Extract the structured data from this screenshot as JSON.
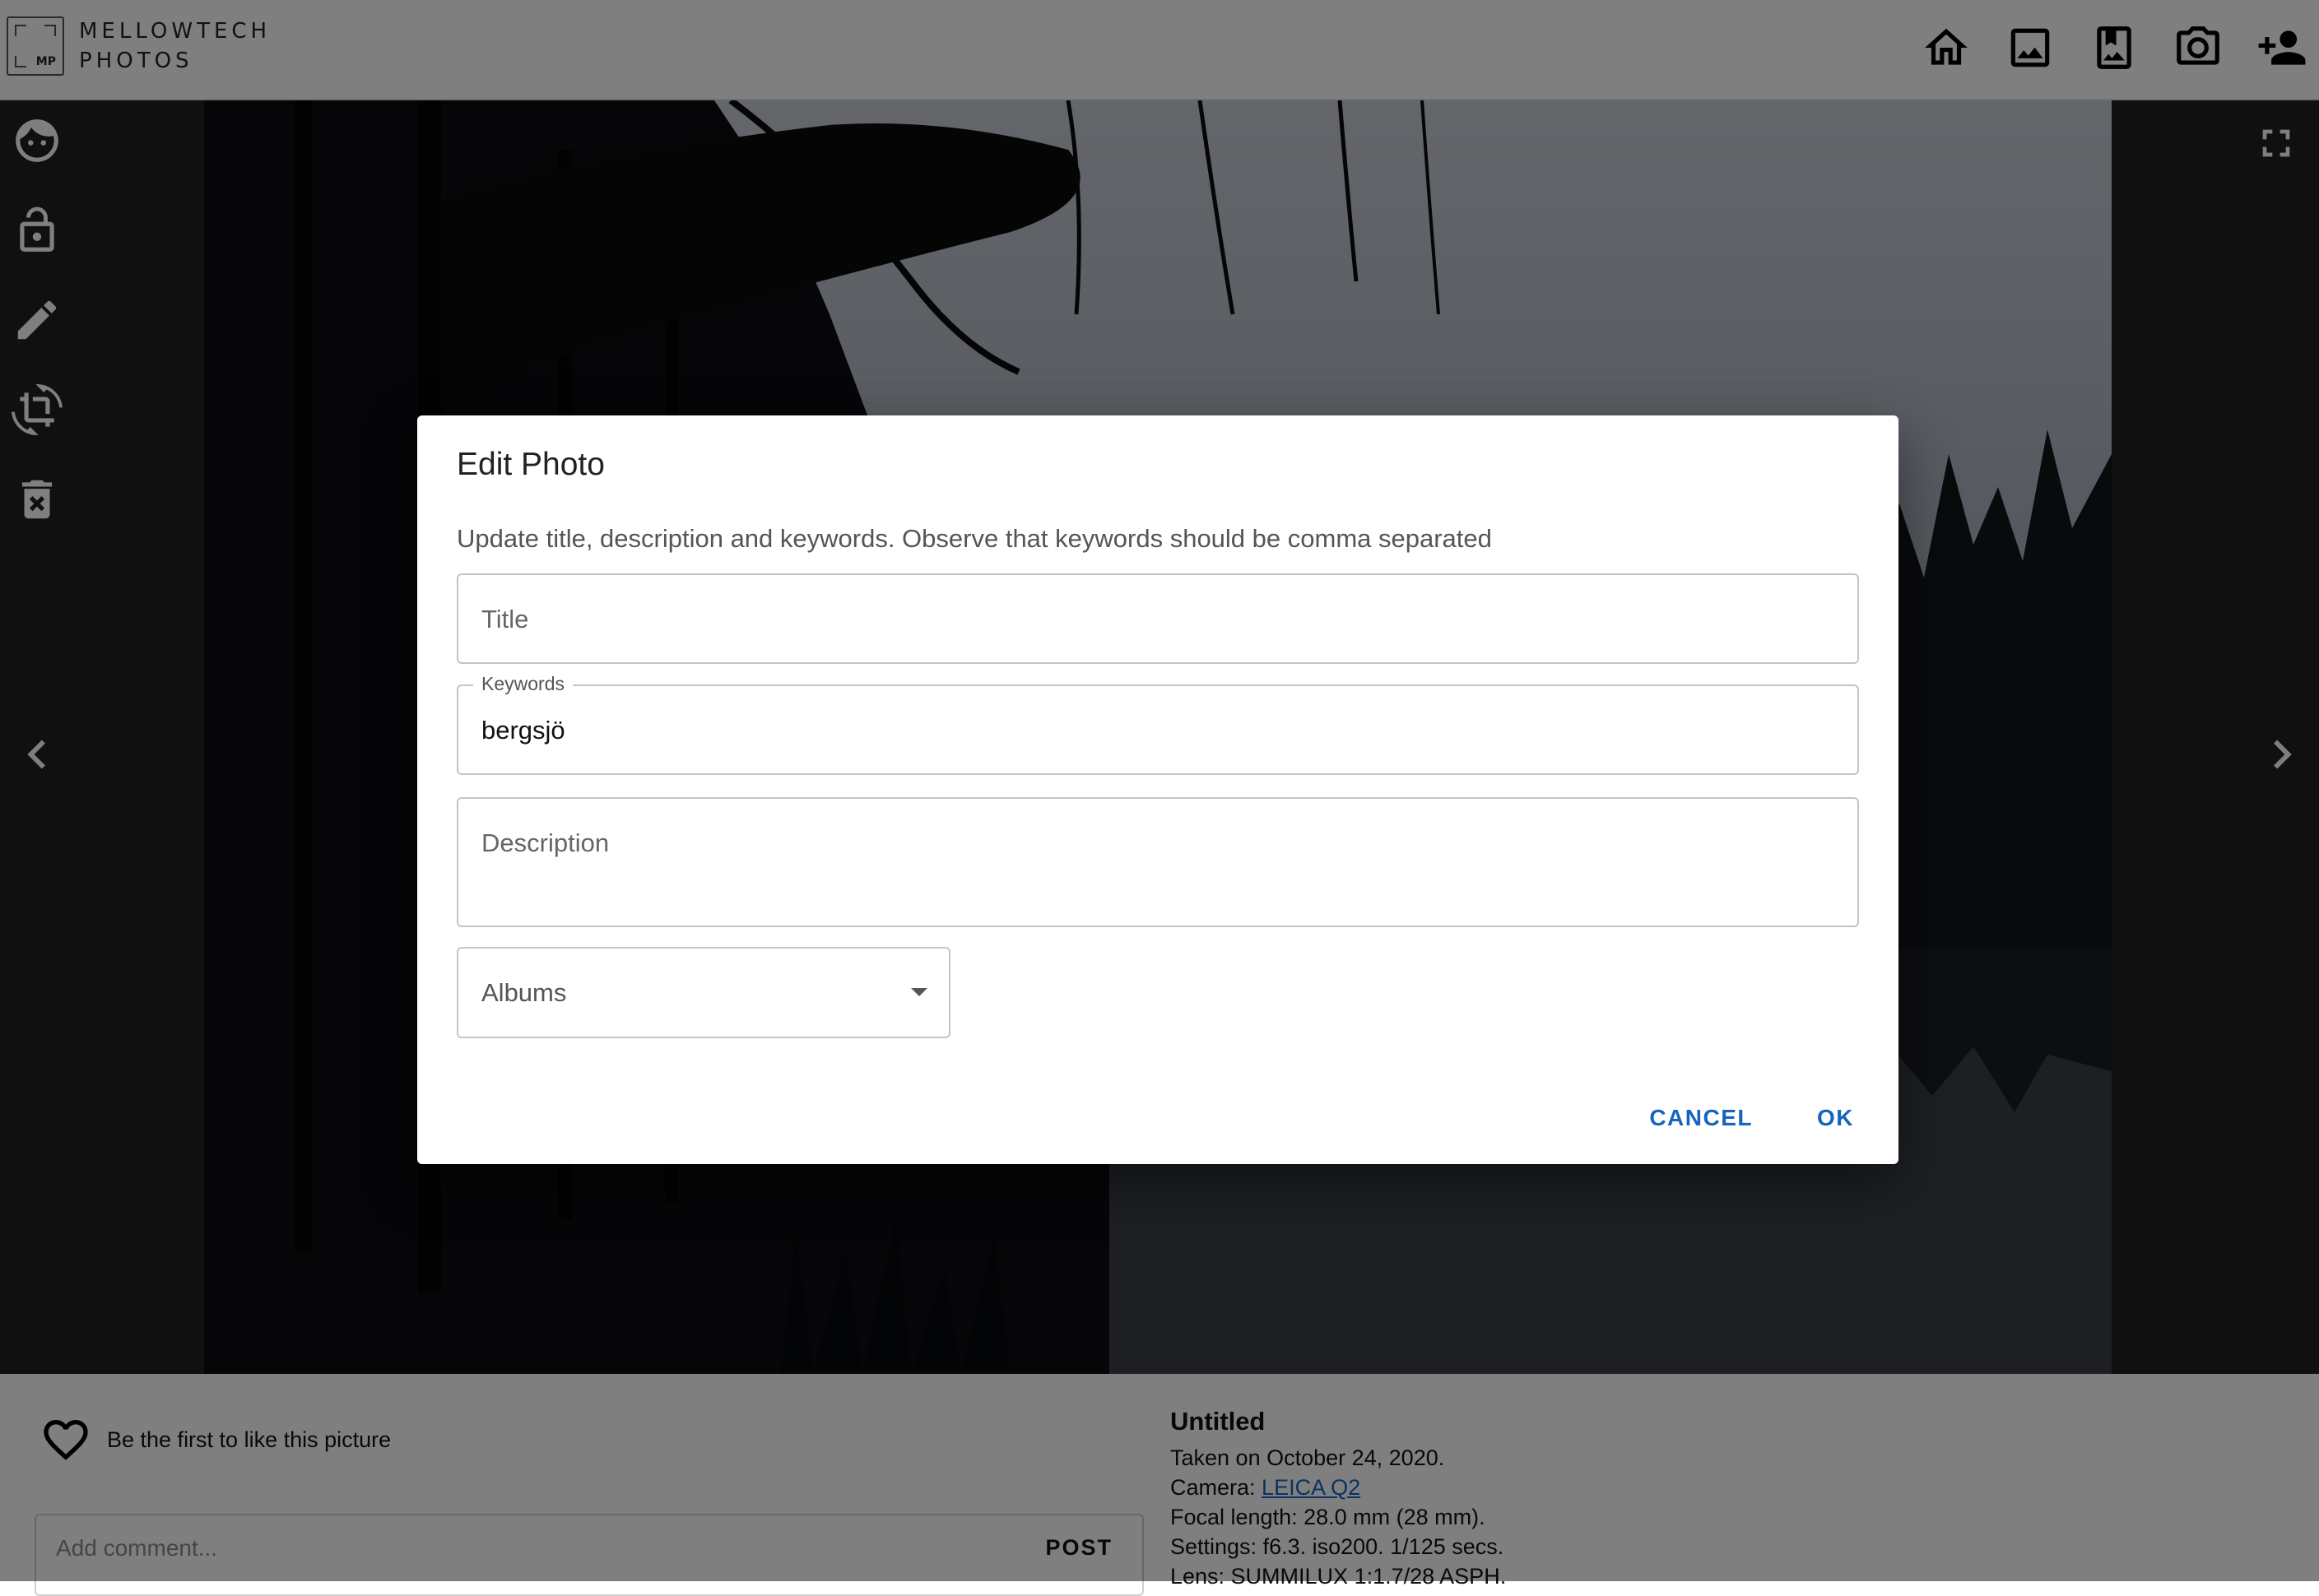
{
  "app": {
    "brand_line1": "MELLOWTECH",
    "brand_line2": "PHOTOS",
    "brand_mono": "MP"
  },
  "topnav": {
    "items": [
      {
        "name": "home",
        "icon": "home-icon"
      },
      {
        "name": "gallery",
        "icon": "image-icon"
      },
      {
        "name": "albums",
        "icon": "photo-album-icon"
      },
      {
        "name": "camera",
        "icon": "camera-icon"
      },
      {
        "name": "add-user",
        "icon": "person-add-icon"
      }
    ]
  },
  "sidebar": {
    "tools": [
      {
        "name": "face",
        "icon": "face-icon"
      },
      {
        "name": "lock",
        "icon": "lock-open-icon"
      },
      {
        "name": "edit",
        "icon": "pencil-icon"
      },
      {
        "name": "crop-rotate",
        "icon": "crop-rotate-icon"
      },
      {
        "name": "delete",
        "icon": "delete-forever-icon"
      }
    ]
  },
  "likes": {
    "text": "Be the first to like this picture"
  },
  "comment": {
    "placeholder": "Add comment...",
    "post_label": "POST"
  },
  "photo_info": {
    "title": "Untitled",
    "taken": "Taken on October 24, 2020.",
    "camera_prefix": "Camera: ",
    "camera_link": "LEICA Q2",
    "focal": "Focal length: 28.0 mm (28 mm).",
    "settings": "Settings: f6.3. iso200. 1/125 secs.",
    "lens": "Lens: SUMMILUX 1:1.7/28 ASPH."
  },
  "modal": {
    "title": "Edit Photo",
    "description": "Update title, description and keywords. Observe that keywords should be comma separated",
    "title_placeholder": "Title",
    "keywords_label": "Keywords",
    "keywords_value": "bergsjö",
    "description_placeholder": "Description",
    "albums_placeholder": "Albums",
    "cancel_label": "CANCEL",
    "ok_label": "OK"
  },
  "colors": {
    "accent": "#1565c0",
    "stage_bg": "#212121",
    "overlay": "rgba(0,0,0,0.5)"
  }
}
